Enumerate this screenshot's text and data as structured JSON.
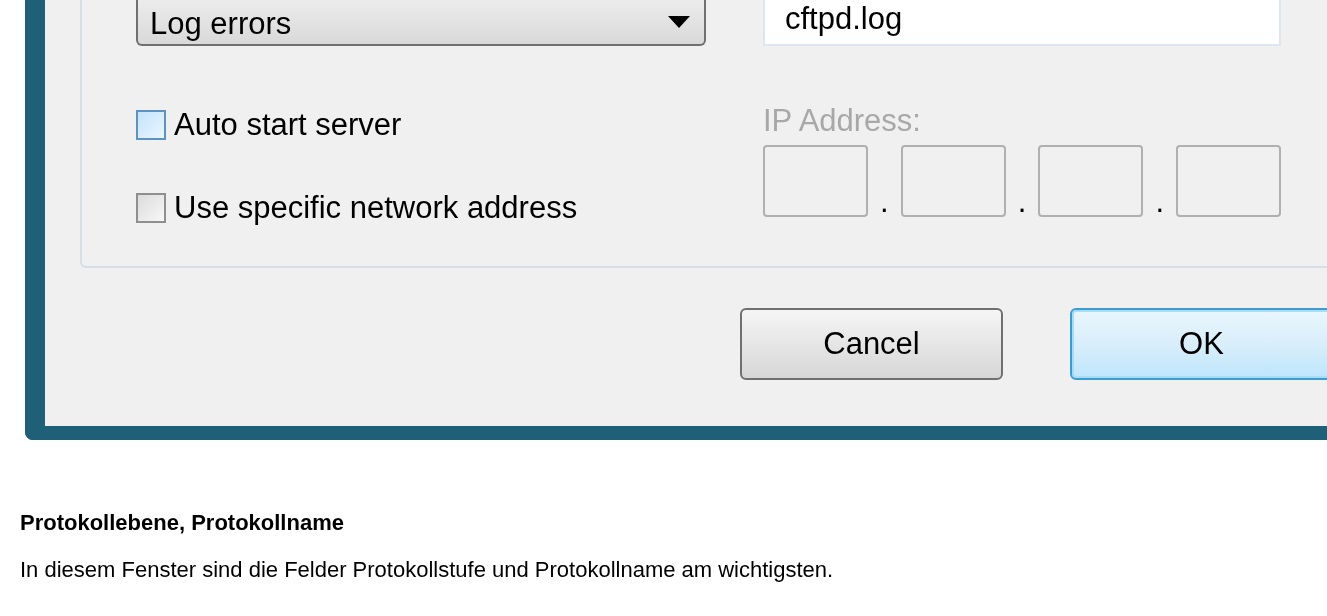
{
  "dialog": {
    "log_level": {
      "value": "Log errors"
    },
    "log_name": {
      "value": "cftpd.log"
    },
    "checkboxes": [
      {
        "label": "Auto start server",
        "checked": false,
        "highlighted": true
      },
      {
        "label": "Use specific network address",
        "checked": false,
        "highlighted": false
      }
    ],
    "ip_address": {
      "label": "IP Address:",
      "disabled": true,
      "separators": [
        ".",
        ".",
        "."
      ],
      "octets": [
        {
          "disabled": true
        },
        {
          "disabled": true
        },
        {
          "disabled": true
        },
        {
          "disabled": true
        }
      ]
    },
    "buttons": [
      {
        "label": "Cancel",
        "default": false
      },
      {
        "label": "OK",
        "default": true
      }
    ]
  },
  "article": {
    "heading": "Protokollebene, Protokollname",
    "paragraphs": [
      "In diesem Fenster sind die Felder Protokollstufe und Protokollname am wichtigsten."
    ]
  }
}
